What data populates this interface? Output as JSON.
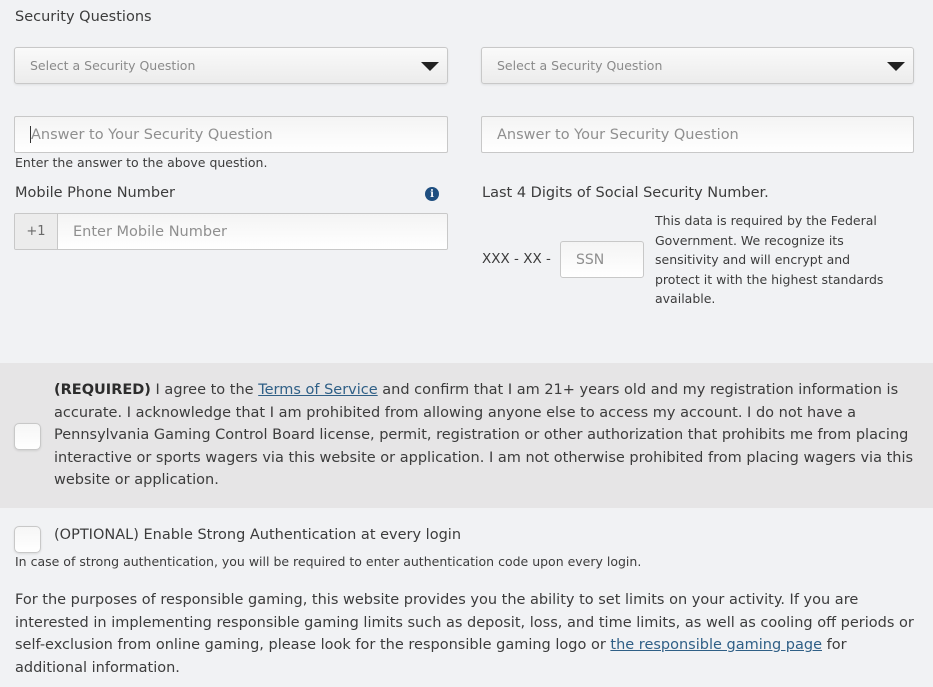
{
  "security": {
    "title": "Security Questions",
    "question1": {
      "placeholder": "Select a Security Question"
    },
    "question2": {
      "placeholder": "Select a Security Question"
    },
    "answer1": {
      "placeholder": "Answer to Your Security Question"
    },
    "answer2": {
      "placeholder": "Answer to Your Security Question"
    },
    "answer_hint": "Enter the answer to the above question."
  },
  "phone": {
    "label": "Mobile Phone Number",
    "info_icon": "info-circle-icon",
    "prefix": "+1",
    "placeholder": "Enter Mobile Number"
  },
  "ssn": {
    "label": "Last 4 Digits of Social Security Number.",
    "prefix": "XXX - XX -",
    "placeholder": "SSN",
    "note": "This data is required by the Federal Government. We recognize its sensitivity and will encrypt and protect it with the highest standards available."
  },
  "terms": {
    "required_tag": "(REQUIRED)",
    "text_before_link": " I agree to the ",
    "link_label": "Terms of Service",
    "text_after_link": " and confirm that I am 21+ years old and my registration information is accurate. I acknowledge that I am prohibited from allowing anyone else to access my account. I do not have a Pennsylvania Gaming Control Board license, permit, registration or other authorization that prohibits me from placing interactive or sports wagers via this website or application. I am not otherwise prohibited from placing wagers via this website or application.",
    "checked": false
  },
  "strong_auth": {
    "label": "(OPTIONAL) Enable Strong Authentication at every login",
    "hint": "In case of strong authentication, you will be required to enter authentication code upon every login.",
    "checked": false
  },
  "responsible": {
    "text": "For the purposes of responsible gaming, this website provides you the ability to set limits on your activity. If you are interested in implementing responsible gaming limits such as deposit, loss, and time limits, as well as cooling off periods or self-exclusion from online gaming, please look for the responsible gaming logo or ",
    "link_label": "the responsible gaming page",
    "text_after": " for additional information."
  },
  "colors": {
    "background": "#f1f2f4",
    "terms_background": "#e6e5e6",
    "link": "#2f5f86",
    "info_icon": "#1f4f80"
  }
}
